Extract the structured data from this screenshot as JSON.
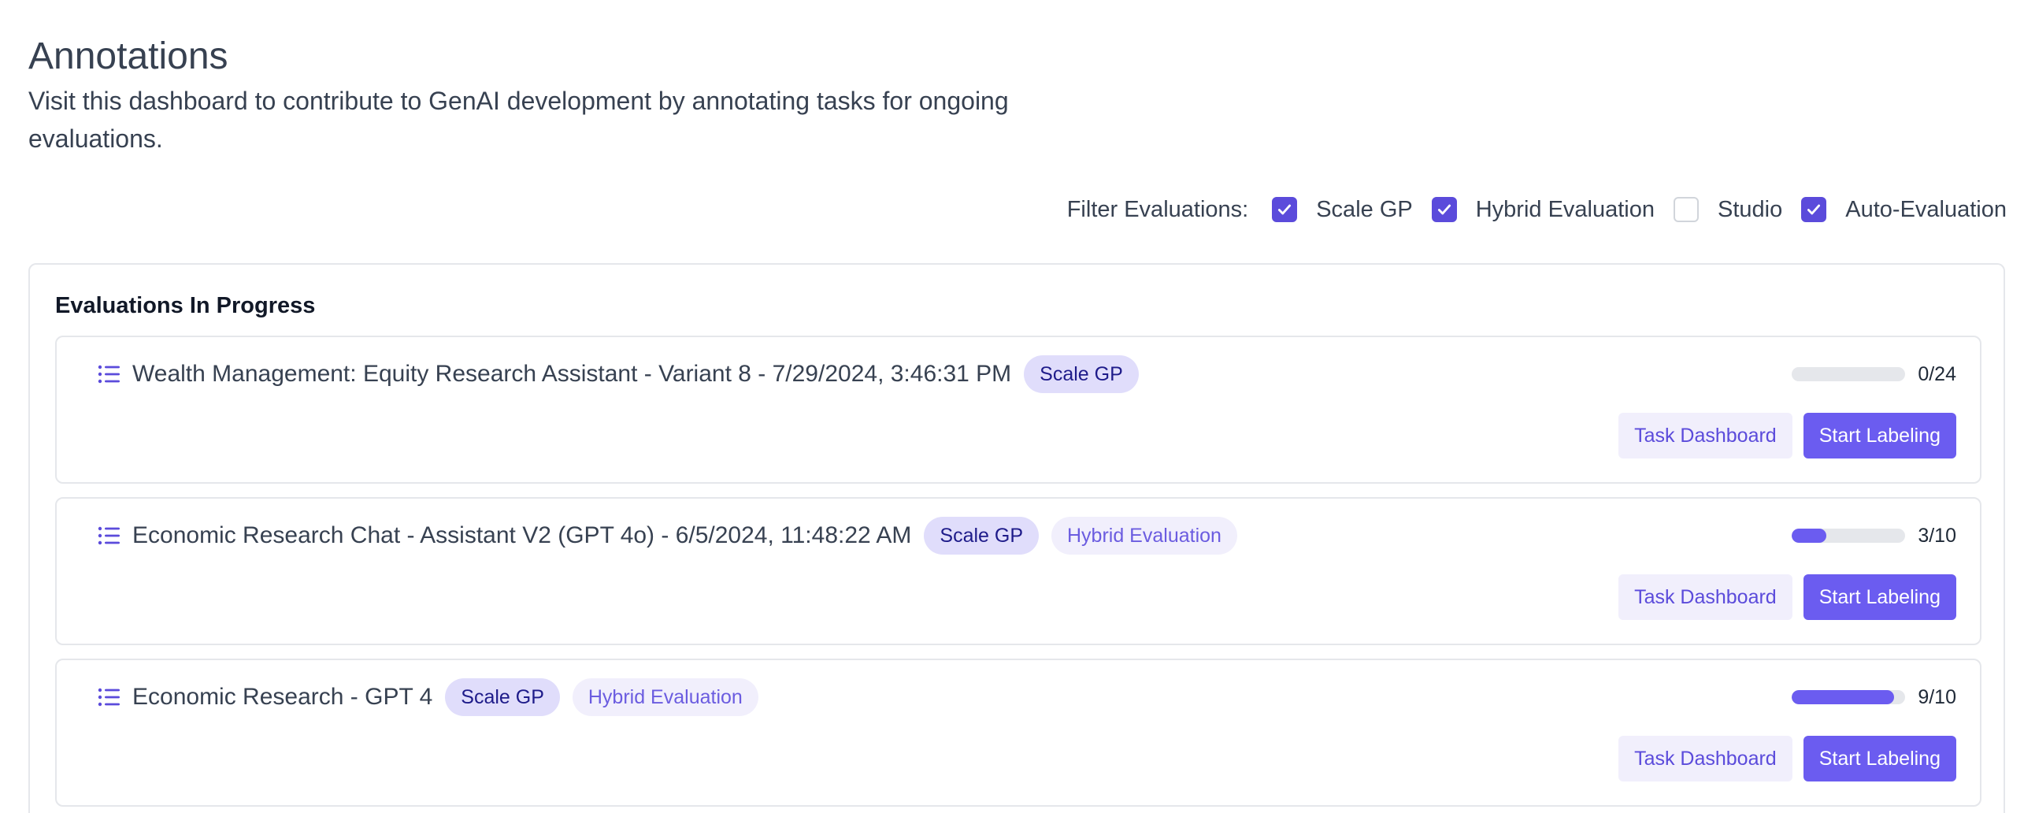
{
  "page": {
    "title": "Annotations",
    "subtitle": "Visit this dashboard to contribute to GenAI development by annotating tasks for ongoing evaluations."
  },
  "filters": {
    "label": "Filter Evaluations:",
    "options": [
      {
        "label": "Scale GP",
        "checked": true
      },
      {
        "label": "Hybrid Evaluation",
        "checked": true
      },
      {
        "label": "Studio",
        "checked": false
      },
      {
        "label": "Auto-Evaluation",
        "checked": true
      }
    ]
  },
  "panel": {
    "title": "Evaluations In Progress"
  },
  "evaluations": [
    {
      "title": "Wealth Management: Equity Research Assistant - Variant 8 - 7/29/2024, 3:46:31 PM",
      "tags": [
        "Scale GP"
      ],
      "progress_text": "0/24",
      "progress_fraction": 0.0,
      "secondary_button": "Task Dashboard",
      "primary_button": "Start Labeling"
    },
    {
      "title": "Economic Research Chat - Assistant V2 (GPT 4o) - 6/5/2024, 11:48:22 AM",
      "tags": [
        "Scale GP",
        "Hybrid Evaluation"
      ],
      "progress_text": "3/10",
      "progress_fraction": 0.3,
      "secondary_button": "Task Dashboard",
      "primary_button": "Start Labeling"
    },
    {
      "title": "Economic Research - GPT 4",
      "tags": [
        "Scale GP",
        "Hybrid Evaluation"
      ],
      "progress_text": "9/10",
      "progress_fraction": 0.9,
      "secondary_button": "Task Dashboard",
      "primary_button": "Start Labeling"
    }
  ],
  "icons": {
    "list": "list-icon",
    "check": "check-icon"
  },
  "colors": {
    "accent": "#6b5cf0",
    "checkbox_checked": "#5b4bdb",
    "tag_primary_bg": "#e0ddfb",
    "tag_secondary_bg": "#f1effc"
  }
}
